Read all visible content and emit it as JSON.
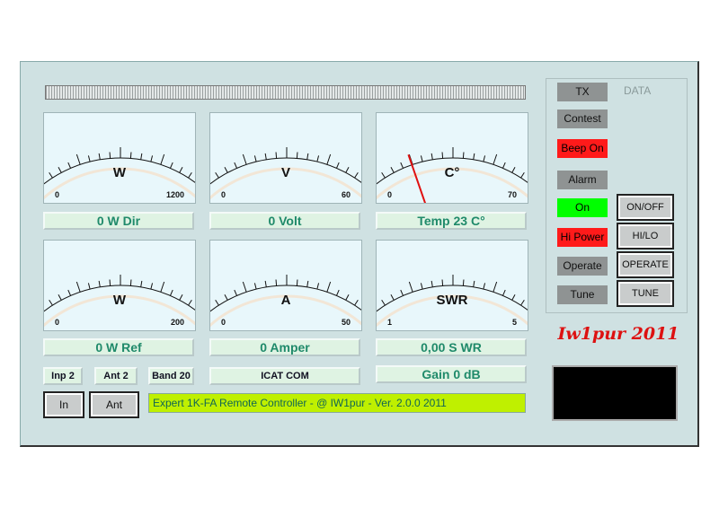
{
  "meters": [
    {
      "unit": "W",
      "min": "0",
      "max": "1200",
      "value_fraction": 0.0,
      "readout": "0 W Dir"
    },
    {
      "unit": "V",
      "min": "0",
      "max": "60",
      "value_fraction": 0.0,
      "readout": "0 Volt"
    },
    {
      "unit": "C°",
      "min": "0",
      "max": "70",
      "value_fraction": 0.33,
      "readout": "Temp 23 C°"
    },
    {
      "unit": "W",
      "min": "0",
      "max": "200",
      "value_fraction": 0.0,
      "readout": "0 W Ref"
    },
    {
      "unit": "A",
      "min": "0",
      "max": "50",
      "value_fraction": 0.0,
      "readout": "0 Amper"
    },
    {
      "unit": "SWR",
      "min": "1",
      "max": "5",
      "value_fraction": 0.0,
      "readout": "0,00  S WR"
    }
  ],
  "info": {
    "inp": "Inp 2",
    "ant": "Ant 2",
    "band": "Band 20",
    "icat": "ICAT COM",
    "gain": "Gain 0 dB"
  },
  "buttons": {
    "in": "In",
    "ant": "Ant",
    "onoff": "ON/OFF",
    "hilo": "HI/LO",
    "operate": "OPERATE",
    "tune": "TUNE"
  },
  "indicators": {
    "tx": "TX",
    "data": "DATA",
    "contest": "Contest",
    "beep": "Beep On",
    "alarm": "Alarm",
    "on": "On",
    "hipower": "Hi Power",
    "operate": "Operate",
    "tune": "Tune"
  },
  "status_text": "Expert 1K-FA Remote Controller - @ IW1pur - Ver. 2.0.0 2011",
  "brand": "Iw1pur 2011",
  "colors": {
    "needle": "#e01010",
    "panel": "#cfe1e2",
    "status_bg": "#bff000"
  }
}
